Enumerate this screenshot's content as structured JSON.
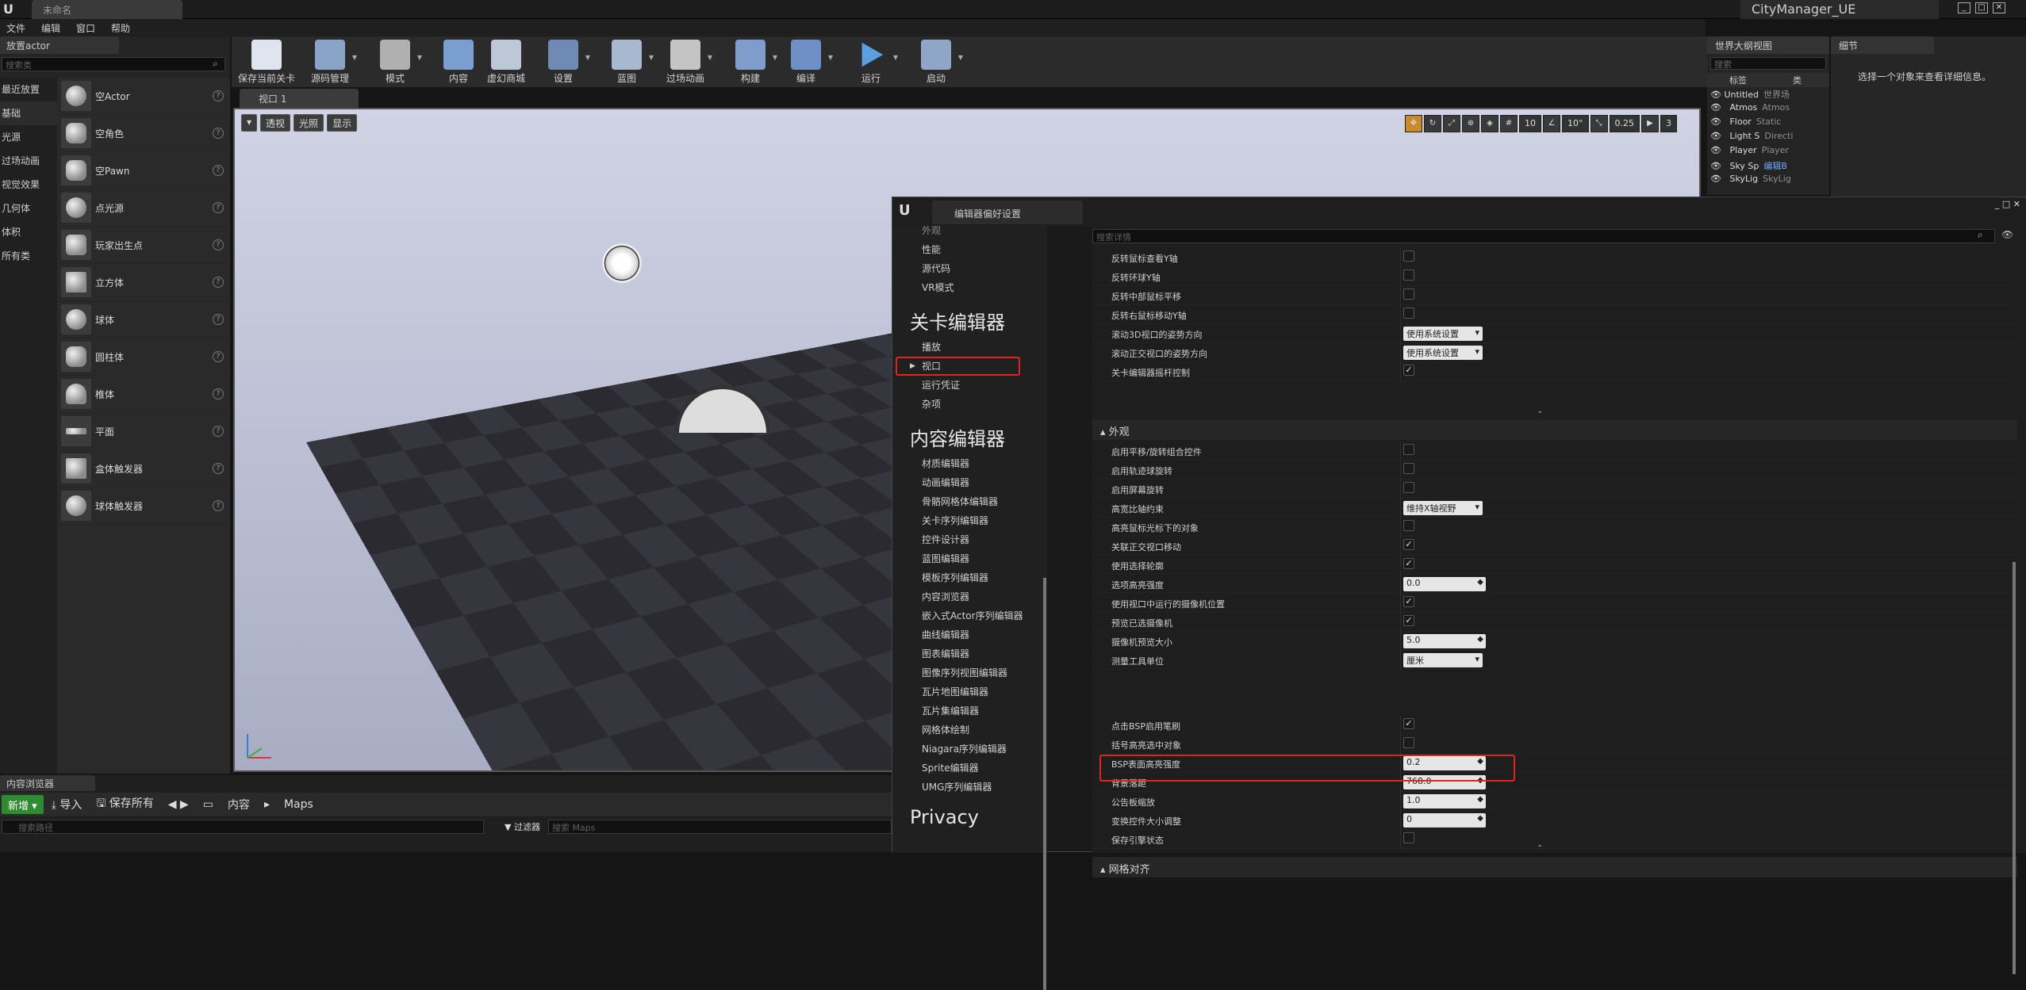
{
  "window": {
    "doc_tab": "未命名",
    "project_name": "CityManager_UE"
  },
  "menubar": [
    "文件",
    "编辑",
    "窗口",
    "帮助"
  ],
  "place_actors": {
    "tab": "放置actor",
    "search_placeholder": "搜索类",
    "categories": [
      "最近放置",
      "基础",
      "光源",
      "过场动画",
      "视觉效果",
      "几何体",
      "体积",
      "所有类"
    ],
    "items": [
      "空Actor",
      "空角色",
      "空Pawn",
      "点光源",
      "玩家出生点",
      "立方体",
      "球体",
      "圆柱体",
      "椎体",
      "平面",
      "盒体触发器",
      "球体触发器"
    ]
  },
  "toolbar": [
    {
      "label": "保存当前关卡",
      "icon": "save-icon"
    },
    {
      "label": "源码管理",
      "icon": "source-control-icon"
    },
    {
      "label": "模式",
      "icon": "modes-icon"
    },
    {
      "label": "内容",
      "icon": "content-icon"
    },
    {
      "label": "虚幻商城",
      "icon": "marketplace-icon"
    },
    {
      "label": "设置",
      "icon": "settings-icon"
    },
    {
      "label": "蓝图",
      "icon": "blueprint-icon"
    },
    {
      "label": "过场动画",
      "icon": "cinematics-icon"
    },
    {
      "label": "构建",
      "icon": "build-icon"
    },
    {
      "label": "编译",
      "icon": "compile-icon"
    },
    {
      "label": "运行",
      "icon": "play-icon"
    },
    {
      "label": "启动",
      "icon": "launch-icon"
    }
  ],
  "viewport": {
    "tab": "视口 1",
    "perspective": "透视",
    "lit": "光照",
    "show": "显示",
    "grid_snap": "10",
    "rot_snap": "10°",
    "scale_snap": "0.25",
    "cam_speed": "3"
  },
  "outliner": {
    "tab": "世界大纲视图",
    "search_placeholder": "搜索",
    "col_label": "标签",
    "col_type": "类",
    "rows": [
      {
        "name": "Untitled",
        "type": "世界场"
      },
      {
        "name": "Atmos",
        "type": "Atmos"
      },
      {
        "name": "Floor",
        "type": "Static"
      },
      {
        "name": "Light S",
        "type": "Directi"
      },
      {
        "name": "Player",
        "type": "Player"
      },
      {
        "name": "Sky Sp",
        "type": "编辑B"
      },
      {
        "name": "SkyLig",
        "type": "SkyLig"
      }
    ]
  },
  "details": {
    "tab": "细节",
    "empty_text": "选择一个对象来查看详细信息。"
  },
  "dialog": {
    "title": "编辑器偏好设置",
    "search_placeholder": "搜索详情",
    "nav_top": [
      "外观",
      "性能",
      "源代码",
      "VR模式"
    ],
    "nav_group1": "关卡编辑器",
    "nav_level": [
      "播放",
      "视口",
      "运行凭证",
      "杂项"
    ],
    "nav_group2": "内容编辑器",
    "nav_content": [
      "材质编辑器",
      "动画编辑器",
      "骨骼网格体编辑器",
      "关卡序列编辑器",
      "控件设计器",
      "蓝图编辑器",
      "模板序列编辑器",
      "内容浏览器",
      "嵌入式Actor序列编辑器",
      "曲线编辑器",
      "图表编辑器",
      "图像序列视图编辑器",
      "瓦片地图编辑器",
      "瓦片集编辑器",
      "网格体绘制",
      "Niagara序列编辑器",
      "Sprite编辑器",
      "UMG序列编辑器"
    ],
    "nav_group3": "Privacy",
    "controls": [
      {
        "label": "反转鼠标查看Y轴",
        "kind": "check",
        "checked": false
      },
      {
        "label": "反转环球Y轴",
        "kind": "check",
        "checked": false
      },
      {
        "label": "反转中部鼠标平移",
        "kind": "check",
        "checked": false
      },
      {
        "label": "反转右鼠标移动Y轴",
        "kind": "check",
        "checked": false
      },
      {
        "label": "滚动3D视口的姿势方向",
        "kind": "combo",
        "value": "使用系统设置"
      },
      {
        "label": "滚动正交视口的姿势方向",
        "kind": "combo",
        "value": "使用系统设置"
      },
      {
        "label": "关卡编辑器摇杆控制",
        "kind": "check",
        "checked": true
      }
    ],
    "appearance_header": "外观",
    "appearance": [
      {
        "label": "启用平移/旋转组合控件",
        "kind": "check",
        "checked": false
      },
      {
        "label": "启用轨迹球旋转",
        "kind": "check",
        "checked": false
      },
      {
        "label": "启用屏幕旋转",
        "kind": "check",
        "checked": false
      },
      {
        "label": "高宽比轴约束",
        "kind": "combo",
        "value": "维持X轴视野"
      },
      {
        "label": "高亮鼠标光标下的对象",
        "kind": "check",
        "checked": false
      },
      {
        "label": "关联正交视口移动",
        "kind": "check",
        "checked": true
      },
      {
        "label": "使用选择轮廓",
        "kind": "check",
        "checked": true
      },
      {
        "label": "选项高亮强度",
        "kind": "num",
        "value": "0.0"
      },
      {
        "label": "使用视口中运行的摄像机位置",
        "kind": "check",
        "checked": true
      },
      {
        "label": "预览已选摄像机",
        "kind": "check",
        "checked": true
      },
      {
        "label": "摄像机预览大小",
        "kind": "num",
        "value": "5.0"
      },
      {
        "label": "测量工具单位",
        "kind": "combo",
        "value": "厘米"
      }
    ],
    "bsp": [
      {
        "label": "点击BSP启用笔刷",
        "kind": "check",
        "checked": true
      },
      {
        "label": "括号高亮选中对象",
        "kind": "check",
        "checked": false
      },
      {
        "label": "BSP表面高亮强度",
        "kind": "num",
        "value": "0.2"
      },
      {
        "label": "背景落距",
        "kind": "num",
        "value": "768.0"
      },
      {
        "label": "公告板缩放",
        "kind": "num",
        "value": "1.0"
      },
      {
        "label": "变换控件大小调整",
        "kind": "num",
        "value": "0"
      },
      {
        "label": "保存引擎状态",
        "kind": "check",
        "checked": false
      }
    ],
    "grid_header": "网格对齐"
  },
  "content_browser": {
    "tab": "内容浏览器",
    "new_label": "新增",
    "import_label": "导入",
    "save_all_label": "保存所有",
    "path_root": "内容",
    "path_leaf": "Maps",
    "search_placeholder": "搜索路径",
    "filter_label": "过滤器",
    "filter_placeholder": "搜索 Maps"
  }
}
